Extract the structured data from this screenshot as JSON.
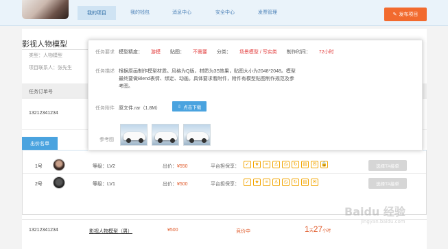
{
  "nav": {
    "items": [
      "我的项目",
      "我的钱包",
      "消息中心",
      "安全中心",
      "发票管理"
    ],
    "publish_label": "发布项目"
  },
  "project": {
    "title": "影视人物模型",
    "category": "类型：人物模型",
    "owner": "项目联系人：张先生"
  },
  "table": {
    "header_order": "任务订单号"
  },
  "row1": {
    "order_no": "13212341234"
  },
  "bids": {
    "tab_label": "出价名单",
    "rows": [
      {
        "rank": "1号",
        "level": "等级：LV2",
        "price_label": "出价：",
        "price": "¥550",
        "guarantee": "平台担保享：",
        "action": "选择TA接单"
      },
      {
        "rank": "2号",
        "level": "等级：LV1",
        "price_label": "出价：",
        "price": "¥500",
        "guarantee": "平台担保享：",
        "action": "选择TA接单"
      }
    ]
  },
  "row2": {
    "order_no": "13212341234",
    "project": "影视人物模型（男）",
    "amount": "¥500",
    "status": "竞价中",
    "days": "1",
    "days_unit": "天",
    "hours": "27",
    "hours_unit": "小时"
  },
  "popup": {
    "req_label": "任务要求",
    "req_precision": "模型精度：",
    "req_precision_val": "游模",
    "req_texture": "贴图：",
    "req_texture_val": "不需要",
    "req_category": "分类：",
    "req_category_val": "场景模型 / 写实类",
    "req_time": "制作时间：",
    "req_time_val": "72小时",
    "desc_label": "任务描述",
    "desc": "根据原画制作模型材质。风格为Q版，材质为3S效果，贴图大小为2048*2048。模型最终要做Blend表情、绑定、动画。具体要求看附件，附件有模型贴图制作规范及参考图。",
    "att_label": "任务附件",
    "att_file": "原文件.rar（1.8M）",
    "download_label": "点击下载",
    "ref_label": "参考图"
  },
  "watermark": {
    "main": "Baidu 经验",
    "sub": "jingyan.baidu.com"
  }
}
